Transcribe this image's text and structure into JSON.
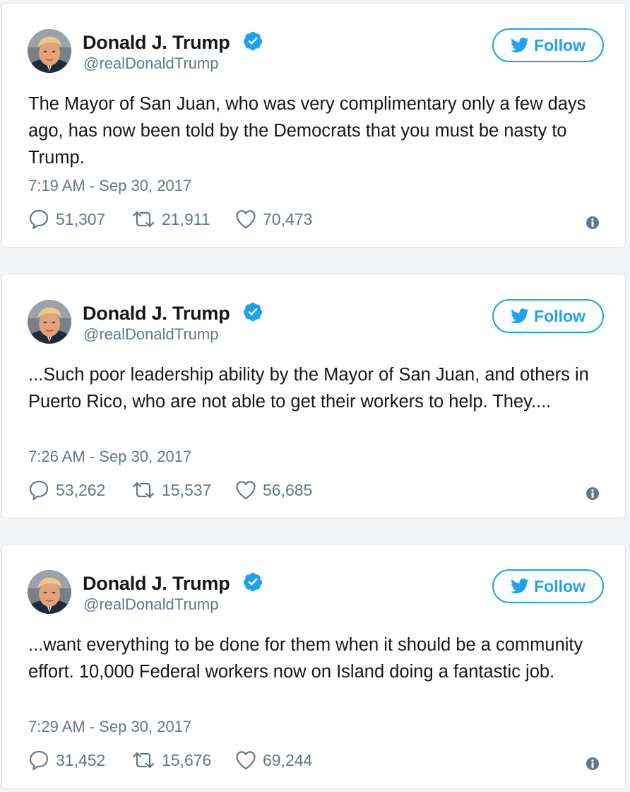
{
  "colors": {
    "accent": "#1da1f2",
    "secondary_text": "#657786",
    "primary_text": "#14171a",
    "card_border": "#dde3e8"
  },
  "icons": [
    "avatar",
    "verified-badge-icon",
    "twitter-bird-icon",
    "reply-icon",
    "retweet-icon",
    "heart-icon",
    "info-icon"
  ],
  "tweets": [
    {
      "author_name": "Donald J. Trump",
      "handle": "@realDonaldTrump",
      "follow_label": "Follow",
      "text": "The Mayor of San Juan, who was very complimentary only a few days ago, has now been told by the Democrats that you must be nasty to Trump.",
      "timestamp": "7:19 AM - Sep 30, 2017",
      "replies": "51,307",
      "retweets": "21,911",
      "likes": "70,473"
    },
    {
      "author_name": "Donald J. Trump",
      "handle": "@realDonaldTrump",
      "follow_label": "Follow",
      "text": "...Such poor leadership ability by the Mayor of San Juan, and others in Puerto Rico, who are not able to get their workers to help. They....",
      "timestamp": "7:26 AM - Sep 30, 2017",
      "replies": "53,262",
      "retweets": "15,537",
      "likes": "56,685"
    },
    {
      "author_name": "Donald J. Trump",
      "handle": "@realDonaldTrump",
      "follow_label": "Follow",
      "text": "...want everything to be done for them when it should be a community effort. 10,000 Federal workers now on Island doing a fantastic job.",
      "timestamp": "7:29 AM - Sep 30, 2017",
      "replies": "31,452",
      "retweets": "15,676",
      "likes": "69,244"
    }
  ]
}
